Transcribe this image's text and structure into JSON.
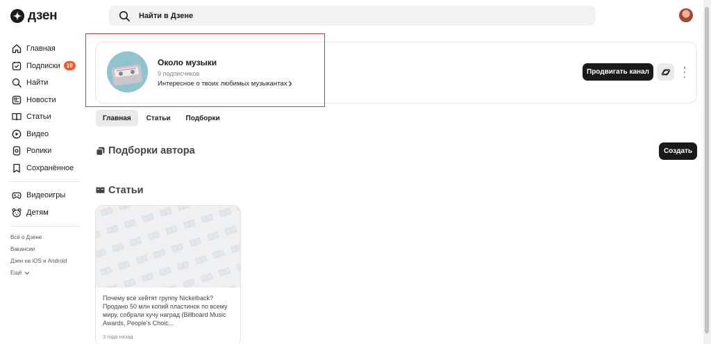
{
  "header": {
    "logo_text": "дзен",
    "search_placeholder": "Найти в Дзене"
  },
  "sidebar": {
    "items": [
      {
        "label": "Главная",
        "icon": "home-icon"
      },
      {
        "label": "Подписки",
        "icon": "subscriptions-icon",
        "badge": "19"
      },
      {
        "label": "Найти",
        "icon": "search-icon"
      },
      {
        "label": "Новости",
        "icon": "news-icon"
      },
      {
        "label": "Статьи",
        "icon": "articles-icon"
      },
      {
        "label": "Видео",
        "icon": "video-icon"
      },
      {
        "label": "Ролики",
        "icon": "shorts-icon"
      },
      {
        "label": "Сохранённое",
        "icon": "bookmark-icon"
      }
    ],
    "items2": [
      {
        "label": "Видеоигры",
        "icon": "gamepad-icon"
      },
      {
        "label": "Детям",
        "icon": "kids-icon"
      }
    ],
    "footer": [
      "Всё о Дзене",
      "Вакансии",
      "Дзен на iOS и Android",
      "Ещё"
    ]
  },
  "channel": {
    "name": "Около музыки",
    "subscribers": "9 подписчиков",
    "description": "Интересное о твоих любимых музыкантах",
    "promote_label": "Продвигать канал"
  },
  "tabs": [
    {
      "label": "Главная",
      "active": true
    },
    {
      "label": "Статьи",
      "active": false
    },
    {
      "label": "Подборки",
      "active": false
    }
  ],
  "collections": {
    "title": "Подборки автора",
    "create_label": "Создать"
  },
  "articles": {
    "title": "Статьи",
    "items": [
      {
        "text": "Почему все хейтят группу Nickelback? Продано 50 млн копий пластинок по всему миру, собрали кучу наград (Billboard Music Awards, People's Choic...",
        "time": "3 года назад"
      }
    ]
  },
  "colors": {
    "accent": "#1a1a1a",
    "badge": "#f25a28",
    "highlight": "#d03a3a"
  }
}
